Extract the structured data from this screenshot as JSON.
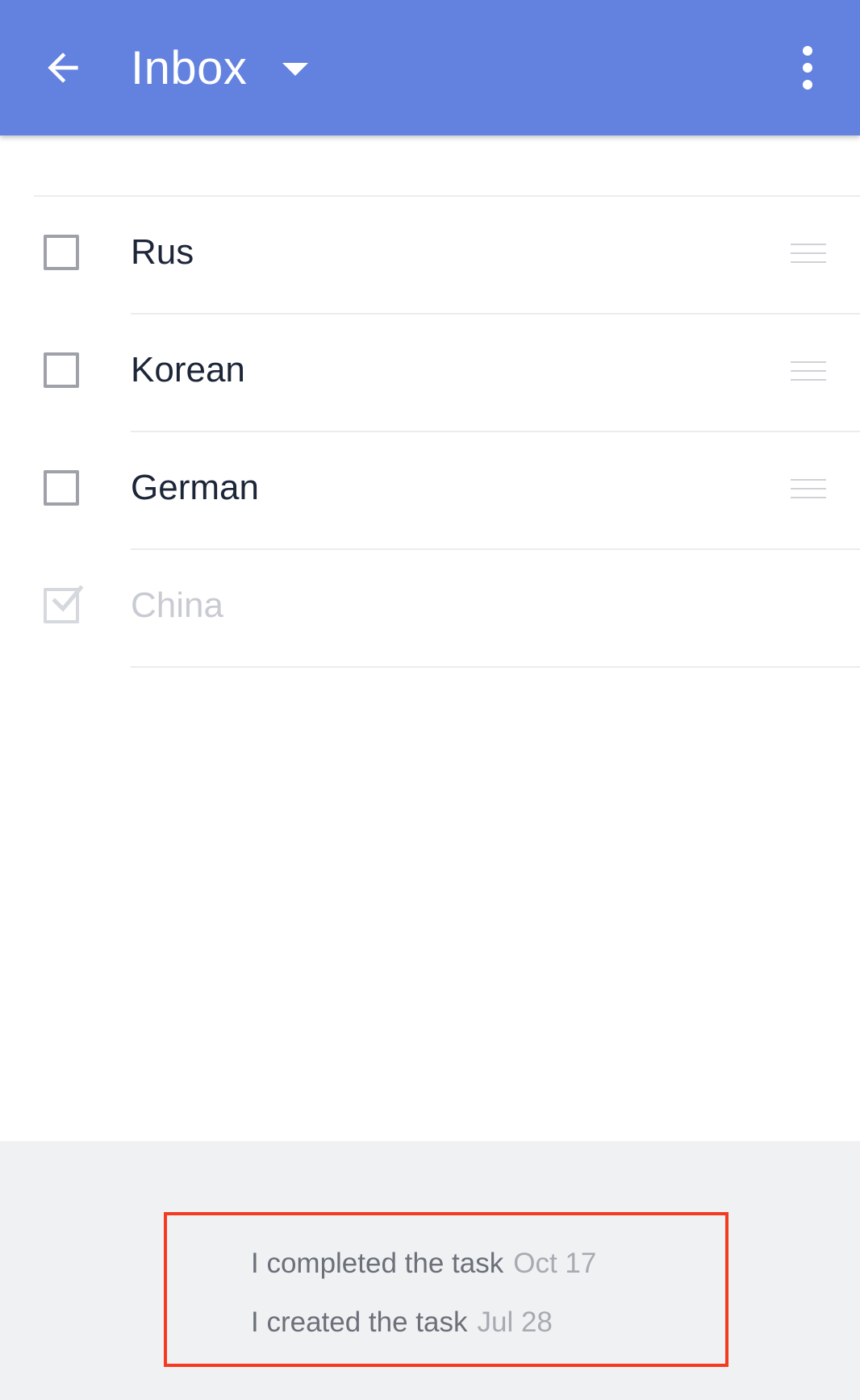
{
  "appbar": {
    "title": "Inbox",
    "color": "#6381df",
    "back_icon": "arrow-back-icon",
    "dropdown_icon": "caret-down-icon",
    "more_icon": "more-vert-icon"
  },
  "tasks": [
    {
      "label": "Rus",
      "completed": false
    },
    {
      "label": "Korean",
      "completed": false
    },
    {
      "label": "German",
      "completed": false
    },
    {
      "label": "China",
      "completed": true
    }
  ],
  "activity": [
    {
      "event": "I completed the task",
      "date": "Oct 17"
    },
    {
      "event": "I created the task",
      "date": "Jul 28"
    }
  ],
  "colors": {
    "highlight_border": "#f43b22",
    "footer_background": "#f0f1f3"
  }
}
